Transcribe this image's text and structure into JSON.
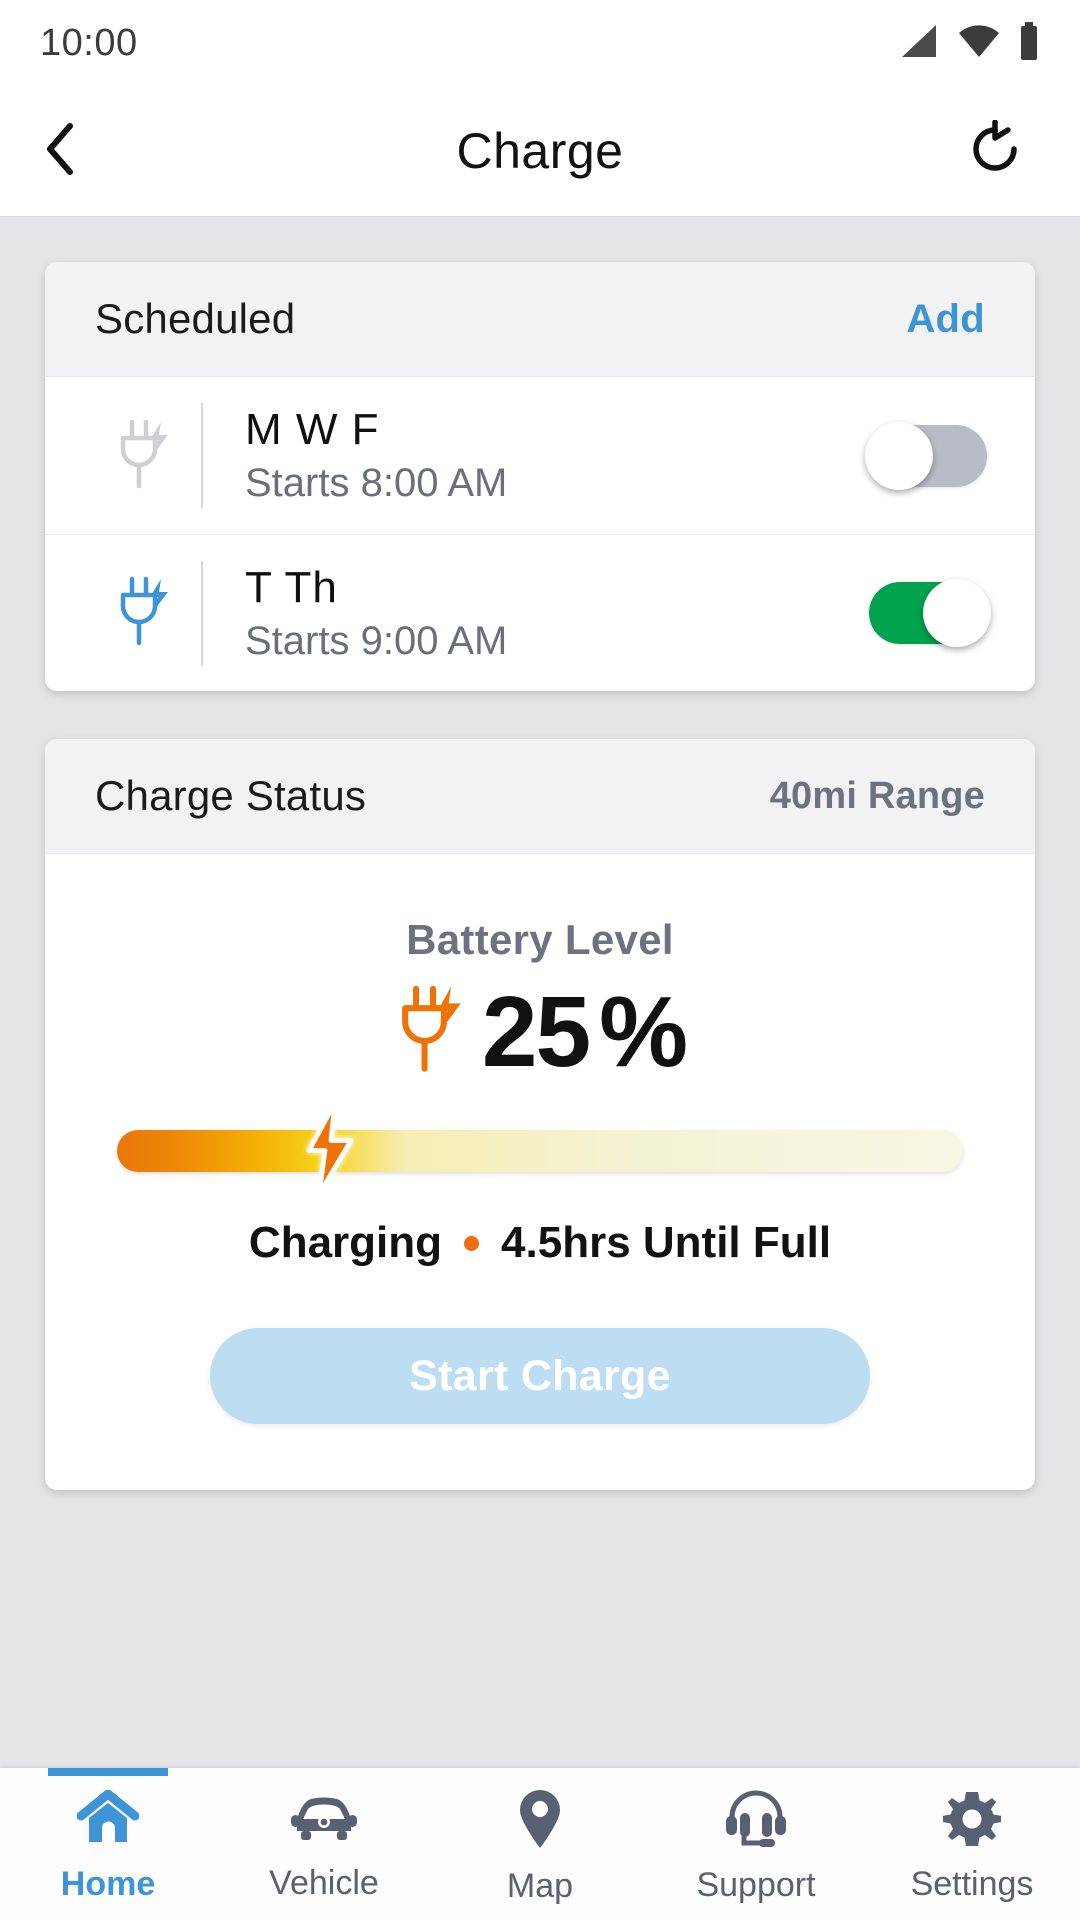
{
  "status_bar": {
    "time": "10:00",
    "icons": [
      "signal-icon",
      "wifi-icon",
      "battery-icon"
    ]
  },
  "app_bar": {
    "back_icon": "chevron-left-icon",
    "title": "Charge",
    "action_icon": "history-refresh-icon"
  },
  "scheduled_card": {
    "title": "Scheduled",
    "add_label": "Add",
    "rows": [
      {
        "icon": "plug-bolt-icon",
        "icon_state": "inactive",
        "days": "M W F",
        "time": "Starts 8:00 AM",
        "toggle_state": "off"
      },
      {
        "icon": "plug-bolt-icon",
        "icon_state": "active",
        "days": "T Th",
        "time": "Starts 9:00 AM",
        "toggle_state": "on"
      }
    ]
  },
  "charge_status_card": {
    "title": "Charge Status",
    "range": "40mi Range",
    "battery_label": "Battery Level",
    "battery_icon": "plug-bolt-icon",
    "battery_value": "25",
    "battery_unit": "%",
    "battery_percent": 25,
    "bar_marker_icon": "lightning-bolt-icon",
    "state_text": "Charging",
    "state_separator": "•",
    "time_remaining": "4.5hrs Until Full",
    "start_button": "Start Charge",
    "start_button_enabled": false
  },
  "bottom_nav": {
    "items": [
      {
        "label": "Home",
        "icon": "home-icon",
        "active": true
      },
      {
        "label": "Vehicle",
        "icon": "car-icon",
        "active": false
      },
      {
        "label": "Map",
        "icon": "map-pin-icon",
        "active": false
      },
      {
        "label": "Support",
        "icon": "headset-icon",
        "active": false
      },
      {
        "label": "Settings",
        "icon": "gear-icon",
        "active": false
      }
    ]
  },
  "colors": {
    "accent_blue": "#3d94d6",
    "toggle_on_green": "#00a34d",
    "toggle_off_gray": "#b9bcc6",
    "charge_orange": "#ef6c12",
    "page_background": "#e5e5e7",
    "card_header": "#f2f2f4",
    "muted_text": "#6c7280",
    "start_button_disabled": "#bcddf2"
  }
}
